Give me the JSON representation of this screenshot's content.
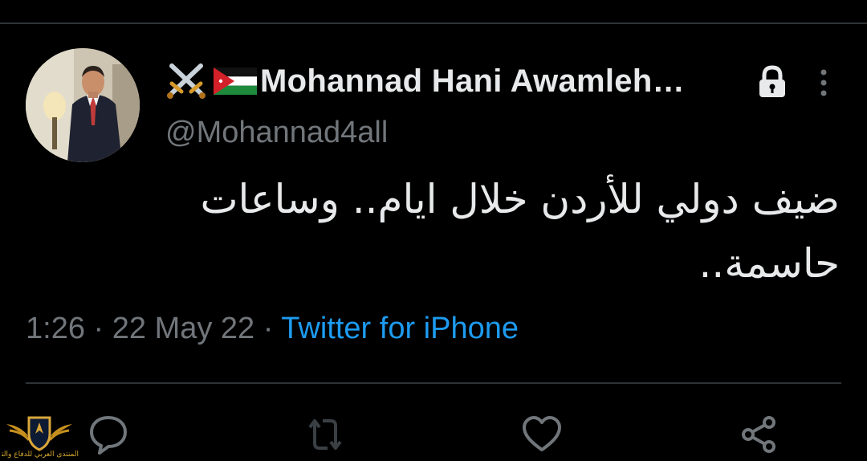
{
  "tweet": {
    "display_name": "Mohannad Hani Awamleh…",
    "handle": "@Mohannad4all",
    "text_line1": "ضيف دولي للأردن خلال ايام.. وساعات",
    "text_line2": "حاسمة..",
    "time": "1:26",
    "date": "22 May 22",
    "separator": "·",
    "source": "Twitter for iPhone"
  },
  "icons": {
    "name_emoji_1": "crossed-swords-icon",
    "name_emoji_2": "jordan-flag-icon",
    "protected": "lock-icon",
    "more": "more-vertical-icon",
    "reply": "reply-icon",
    "retweet": "retweet-icon",
    "like": "like-icon",
    "share": "share-icon"
  },
  "watermark": {
    "text": "المنتدى العربي للدفاع والتسليح"
  },
  "colors": {
    "background": "#000000",
    "primary_text": "#e7e9ea",
    "secondary_text": "#71767b",
    "link": "#1d9bf0",
    "divider": "#2f3336"
  }
}
